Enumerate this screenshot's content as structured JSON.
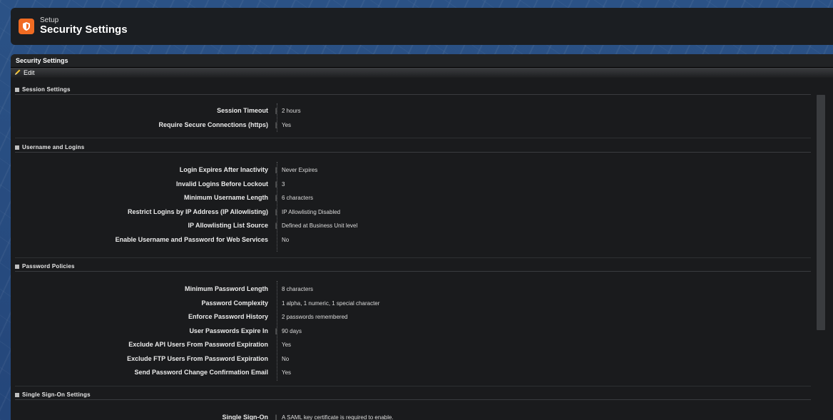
{
  "header": {
    "eyebrow": "Setup",
    "title": "Security Settings",
    "icon": "shield-icon",
    "icon_color": "#f06b22"
  },
  "panel": {
    "title": "Security Settings",
    "edit_label": "Edit"
  },
  "sections": {
    "session": {
      "title": "Session Settings",
      "rows": [
        {
          "label": "Session Timeout",
          "value": "2 hours"
        },
        {
          "label": "Require Secure Connections (https)",
          "value": "Yes"
        }
      ]
    },
    "username": {
      "title": "Username and Logins",
      "rows": [
        {
          "label": "Login Expires After Inactivity",
          "value": "Never Expires"
        },
        {
          "label": "Invalid Logins Before Lockout",
          "value": "3"
        },
        {
          "label": "Minimum Username Length",
          "value": "6 characters"
        },
        {
          "label": "Restrict Logins by IP Address (IP Allowlisting)",
          "value": "IP Allowlisting Disabled"
        },
        {
          "label": "IP Allowlisting List Source",
          "value": "Defined at Business Unit level"
        },
        {
          "label": "Enable Username and Password for Web Services",
          "value": "No"
        }
      ]
    },
    "password": {
      "title": "Password Policies",
      "rows": [
        {
          "label": "Minimum Password Length",
          "value": "8 characters"
        },
        {
          "label": "Password Complexity",
          "value": "1 alpha, 1 numeric, 1 special character"
        },
        {
          "label": "Enforce Password History",
          "value": "2 passwords remembered"
        },
        {
          "label": "User Passwords Expire In",
          "value": "90 days"
        },
        {
          "label": "Exclude API Users From Password Expiration",
          "value": "Yes"
        },
        {
          "label": "Exclude FTP Users From Password Expiration",
          "value": "No"
        },
        {
          "label": "Send Password Change Confirmation Email",
          "value": "Yes"
        }
      ]
    },
    "sso": {
      "title": "Single Sign-On Settings",
      "rows": [
        {
          "label": "Single Sign-On",
          "value": "A SAML key certificate is required to enable."
        }
      ]
    }
  }
}
